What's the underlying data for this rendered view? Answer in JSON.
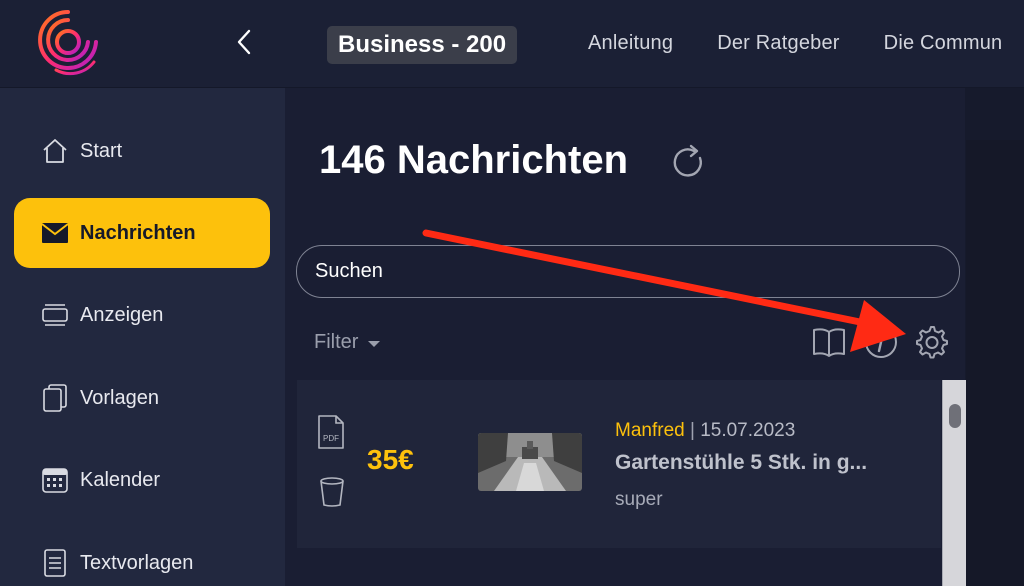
{
  "header": {
    "plan_badge": "Business - 200",
    "nav": [
      "Anleitung",
      "Der Ratgeber",
      "Die Commun"
    ]
  },
  "sidebar": {
    "items": [
      {
        "label": "Start",
        "icon": "home-icon",
        "active": false
      },
      {
        "label": "Nachrichten",
        "icon": "envelope-icon",
        "active": true
      },
      {
        "label": "Anzeigen",
        "icon": "ads-icon",
        "active": false
      },
      {
        "label": "Vorlagen",
        "icon": "templates-icon",
        "active": false
      },
      {
        "label": "Kalender",
        "icon": "calendar-icon",
        "active": false
      },
      {
        "label": "Textvorlagen",
        "icon": "document-icon",
        "active": false
      }
    ]
  },
  "main": {
    "title": "146 Nachrichten",
    "search_placeholder": "Suchen",
    "filter_label": "Filter"
  },
  "messages": [
    {
      "price": "35€",
      "sender": "Manfred",
      "separator": "|",
      "date": "15.07.2023",
      "title": "Gartenstühle 5 Stk. in g...",
      "preview": "super",
      "attachment_label": "PDF"
    }
  ],
  "colors": {
    "accent": "#fdc10c",
    "sidebar_bg": "#22283f",
    "main_bg": "#1a1e33",
    "annotation_arrow": "#ff2a14"
  }
}
